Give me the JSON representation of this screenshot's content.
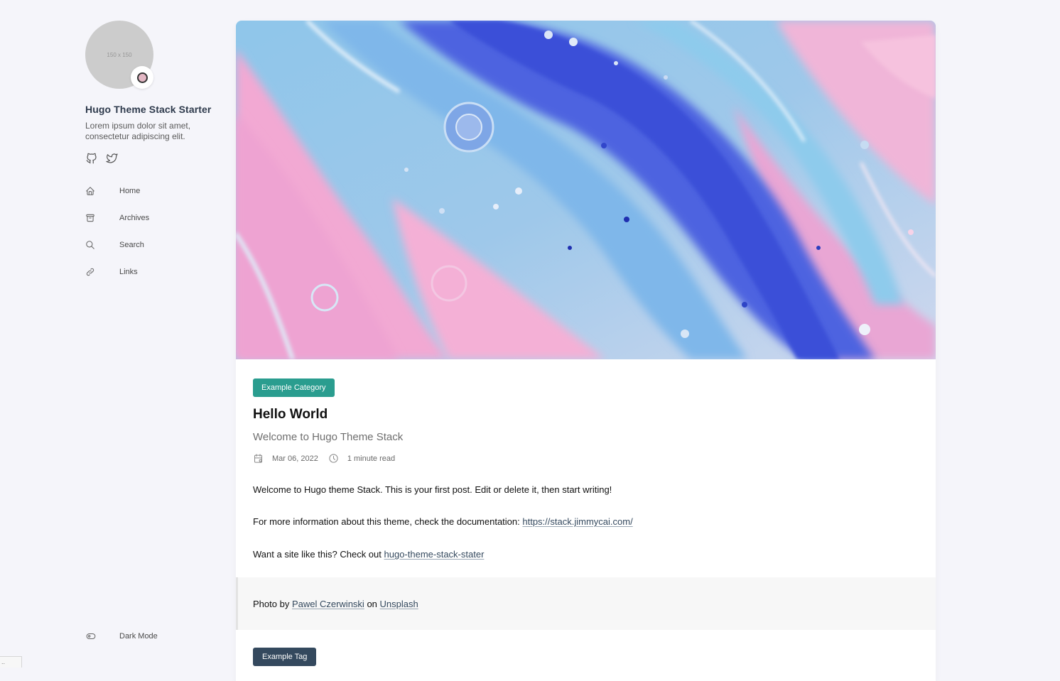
{
  "sidebar": {
    "avatar_placeholder": "150 x 150",
    "site_name": "Hugo Theme Stack Starter",
    "site_description": "Lorem ipsum dolor sit amet, consectetur adipiscing elit.",
    "social": [
      {
        "icon": "github-icon"
      },
      {
        "icon": "twitter-icon"
      }
    ],
    "menu": [
      {
        "label": "Home",
        "icon": "home-icon"
      },
      {
        "label": "Archives",
        "icon": "archive-icon"
      },
      {
        "label": "Search",
        "icon": "search-icon"
      },
      {
        "label": "Links",
        "icon": "link-icon"
      }
    ],
    "dark_mode_label": "Dark Mode"
  },
  "article": {
    "category": "Example Category",
    "title": "Hello World",
    "subtitle": "Welcome to Hugo Theme Stack",
    "date": "Mar 06, 2022",
    "reading_time": "1 minute read",
    "paragraph1": "Welcome to Hugo theme Stack. This is your first post. Edit or delete it, then start writing!",
    "paragraph2_text": "For more information about this theme, check the documentation: ",
    "paragraph2_link": "https://stack.jimmycai.com/",
    "paragraph3_text": "Want a site like this? Check out ",
    "paragraph3_link": "hugo-theme-stack-stater",
    "credit_prefix": "Photo by ",
    "credit_author": "Pawel Czerwinski",
    "credit_middle": " on ",
    "credit_site": "Unsplash",
    "tag": "Example Tag"
  },
  "corner_mark": "..",
  "colors": {
    "background": "#f5f5fa",
    "category_badge": "#2a9d8f",
    "tag_badge": "#34495e",
    "link": "#34495e"
  }
}
